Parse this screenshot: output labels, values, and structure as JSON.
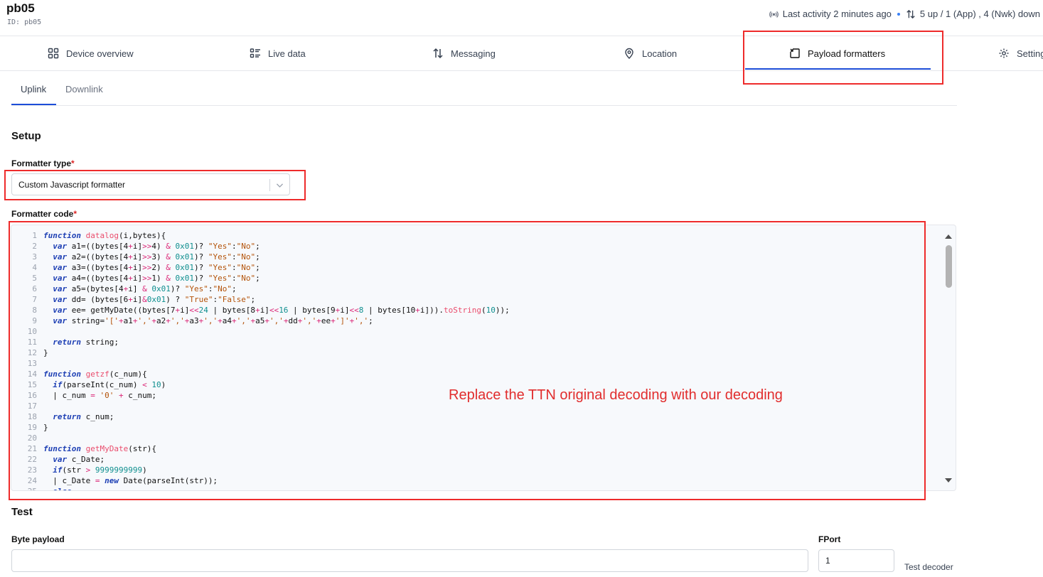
{
  "device": {
    "name": "pb05",
    "id_line": "ID: pb05"
  },
  "status": {
    "last_activity": "Last activity 2 minutes ago",
    "traffic": "5 up / 1 (App) , 4 (Nwk) down"
  },
  "tabs": [
    {
      "label": "Device overview",
      "icon": "grid-icon"
    },
    {
      "label": "Live data",
      "icon": "list-icon"
    },
    {
      "label": "Messaging",
      "icon": "arrows-updown-icon"
    },
    {
      "label": "Location",
      "icon": "location-pin-icon"
    },
    {
      "label": "Payload formatters",
      "icon": "formatter-icon",
      "active": true
    },
    {
      "label": "Settings",
      "icon": "gear-icon"
    }
  ],
  "subtabs": [
    {
      "label": "Uplink",
      "active": true
    },
    {
      "label": "Downlink"
    }
  ],
  "setup": {
    "heading": "Setup",
    "formatter_type_label": "Formatter type",
    "formatter_type_value": "Custom Javascript formatter",
    "formatter_code_label": "Formatter code",
    "required_mark": "*"
  },
  "code_lines": [
    {
      "n": "1",
      "segs": [
        [
          "function",
          "kw"
        ],
        [
          " ",
          ""
        ],
        [
          "datalog",
          "fn"
        ],
        [
          "(i,bytes){",
          ""
        ]
      ]
    },
    {
      "n": "2",
      "segs": [
        [
          "  ",
          ""
        ],
        [
          "var",
          "kw"
        ],
        [
          " a1=((bytes[4",
          ""
        ],
        [
          "+",
          "op"
        ],
        [
          "i]",
          ""
        ],
        [
          ">>",
          "op"
        ],
        [
          "4) ",
          ""
        ],
        [
          "&",
          "op"
        ],
        [
          " ",
          ""
        ],
        [
          "0x01",
          "num"
        ],
        [
          ")? ",
          ""
        ],
        [
          "\"Yes\"",
          "str"
        ],
        [
          ":",
          ""
        ],
        [
          "\"No\"",
          "str"
        ],
        [
          ";",
          ""
        ]
      ]
    },
    {
      "n": "3",
      "segs": [
        [
          "  ",
          ""
        ],
        [
          "var",
          "kw"
        ],
        [
          " a2=((bytes[4",
          ""
        ],
        [
          "+",
          "op"
        ],
        [
          "i]",
          ""
        ],
        [
          ">>",
          "op"
        ],
        [
          "3) ",
          ""
        ],
        [
          "&",
          "op"
        ],
        [
          " ",
          ""
        ],
        [
          "0x01",
          "num"
        ],
        [
          ")? ",
          ""
        ],
        [
          "\"Yes\"",
          "str"
        ],
        [
          ":",
          ""
        ],
        [
          "\"No\"",
          "str"
        ],
        [
          ";",
          ""
        ]
      ]
    },
    {
      "n": "4",
      "segs": [
        [
          "  ",
          ""
        ],
        [
          "var",
          "kw"
        ],
        [
          " a3=((bytes[4",
          ""
        ],
        [
          "+",
          "op"
        ],
        [
          "i]",
          ""
        ],
        [
          ">>",
          "op"
        ],
        [
          "2) ",
          ""
        ],
        [
          "&",
          "op"
        ],
        [
          " ",
          ""
        ],
        [
          "0x01",
          "num"
        ],
        [
          ")? ",
          ""
        ],
        [
          "\"Yes\"",
          "str"
        ],
        [
          ":",
          ""
        ],
        [
          "\"No\"",
          "str"
        ],
        [
          ";",
          ""
        ]
      ]
    },
    {
      "n": "5",
      "segs": [
        [
          "  ",
          ""
        ],
        [
          "var",
          "kw"
        ],
        [
          " a4=((bytes[4",
          ""
        ],
        [
          "+",
          "op"
        ],
        [
          "i]",
          ""
        ],
        [
          ">>",
          "op"
        ],
        [
          "1) ",
          ""
        ],
        [
          "&",
          "op"
        ],
        [
          " ",
          ""
        ],
        [
          "0x01",
          "num"
        ],
        [
          ")? ",
          ""
        ],
        [
          "\"Yes\"",
          "str"
        ],
        [
          ":",
          ""
        ],
        [
          "\"No\"",
          "str"
        ],
        [
          ";",
          ""
        ]
      ]
    },
    {
      "n": "6",
      "segs": [
        [
          "  ",
          ""
        ],
        [
          "var",
          "kw"
        ],
        [
          " a5=(bytes[4",
          ""
        ],
        [
          "+",
          "op"
        ],
        [
          "i] ",
          ""
        ],
        [
          "&",
          "op"
        ],
        [
          " ",
          ""
        ],
        [
          "0x01",
          "num"
        ],
        [
          ")? ",
          ""
        ],
        [
          "\"Yes\"",
          "str"
        ],
        [
          ":",
          ""
        ],
        [
          "\"No\"",
          "str"
        ],
        [
          ";",
          ""
        ]
      ]
    },
    {
      "n": "7",
      "segs": [
        [
          "  ",
          ""
        ],
        [
          "var",
          "kw"
        ],
        [
          " dd= (bytes[6",
          ""
        ],
        [
          "+",
          "op"
        ],
        [
          "i]",
          ""
        ],
        [
          "&",
          "op"
        ],
        [
          "0x01",
          "num"
        ],
        [
          ") ? ",
          ""
        ],
        [
          "\"True\"",
          "str"
        ],
        [
          ":",
          ""
        ],
        [
          "\"False\"",
          "str"
        ],
        [
          ";",
          ""
        ]
      ]
    },
    {
      "n": "8",
      "segs": [
        [
          "  ",
          ""
        ],
        [
          "var",
          "kw"
        ],
        [
          " ee= getMyDate((bytes[7",
          ""
        ],
        [
          "+",
          "op"
        ],
        [
          "i]",
          ""
        ],
        [
          "<<",
          "op"
        ],
        [
          "24",
          "num"
        ],
        [
          " | bytes[8",
          ""
        ],
        [
          "+",
          "op"
        ],
        [
          "i]",
          ""
        ],
        [
          "<<",
          "op"
        ],
        [
          "16",
          "num"
        ],
        [
          " | bytes[9",
          ""
        ],
        [
          "+",
          "op"
        ],
        [
          "i]",
          ""
        ],
        [
          "<<",
          "op"
        ],
        [
          "8",
          "num"
        ],
        [
          " | bytes[10",
          ""
        ],
        [
          "+",
          "op"
        ],
        [
          "i])).",
          ""
        ],
        [
          "toString",
          "fn"
        ],
        [
          "(",
          ""
        ],
        [
          "10",
          "num"
        ],
        [
          "));",
          ""
        ]
      ]
    },
    {
      "n": "9",
      "segs": [
        [
          "  ",
          ""
        ],
        [
          "var",
          "kw"
        ],
        [
          " string=",
          ""
        ],
        [
          "'['",
          "str"
        ],
        [
          "+",
          "op"
        ],
        [
          "a1",
          ""
        ],
        [
          "+",
          "op"
        ],
        [
          "','",
          "str"
        ],
        [
          "+",
          "op"
        ],
        [
          "a2",
          ""
        ],
        [
          "+",
          "op"
        ],
        [
          "','",
          "str"
        ],
        [
          "+",
          "op"
        ],
        [
          "a3",
          ""
        ],
        [
          "+",
          "op"
        ],
        [
          "','",
          "str"
        ],
        [
          "+",
          "op"
        ],
        [
          "a4",
          ""
        ],
        [
          "+",
          "op"
        ],
        [
          "','",
          "str"
        ],
        [
          "+",
          "op"
        ],
        [
          "a5",
          ""
        ],
        [
          "+",
          "op"
        ],
        [
          "','",
          "str"
        ],
        [
          "+",
          "op"
        ],
        [
          "dd",
          ""
        ],
        [
          "+",
          "op"
        ],
        [
          "','",
          "str"
        ],
        [
          "+",
          "op"
        ],
        [
          "ee",
          ""
        ],
        [
          "+",
          "op"
        ],
        [
          "']'",
          "str"
        ],
        [
          "+",
          "op"
        ],
        [
          "','",
          "str"
        ],
        [
          ";",
          ""
        ]
      ]
    },
    {
      "n": "10",
      "segs": []
    },
    {
      "n": "11",
      "segs": [
        [
          "  ",
          ""
        ],
        [
          "return",
          "kw"
        ],
        [
          " string;",
          ""
        ]
      ]
    },
    {
      "n": "12",
      "segs": [
        [
          "}",
          ""
        ]
      ]
    },
    {
      "n": "13",
      "segs": []
    },
    {
      "n": "14",
      "segs": [
        [
          "function",
          "kw"
        ],
        [
          " ",
          ""
        ],
        [
          "getzf",
          "fn"
        ],
        [
          "(c_num){",
          ""
        ]
      ]
    },
    {
      "n": "15",
      "segs": [
        [
          "  ",
          ""
        ],
        [
          "if",
          "kw"
        ],
        [
          "(parseInt(c_num) ",
          ""
        ],
        [
          "<",
          "op"
        ],
        [
          " ",
          ""
        ],
        [
          "10",
          "num"
        ],
        [
          ")",
          ""
        ]
      ]
    },
    {
      "n": "16",
      "segs": [
        [
          "  | c_num ",
          ""
        ],
        [
          "=",
          "op"
        ],
        [
          " ",
          ""
        ],
        [
          "'0'",
          "str"
        ],
        [
          " ",
          ""
        ],
        [
          "+",
          "op"
        ],
        [
          " c_num;",
          ""
        ]
      ]
    },
    {
      "n": "17",
      "segs": []
    },
    {
      "n": "18",
      "segs": [
        [
          "  ",
          ""
        ],
        [
          "return",
          "kw"
        ],
        [
          " c_num;",
          ""
        ]
      ]
    },
    {
      "n": "19",
      "segs": [
        [
          "}",
          ""
        ]
      ]
    },
    {
      "n": "20",
      "segs": []
    },
    {
      "n": "21",
      "segs": [
        [
          "function",
          "kw"
        ],
        [
          " ",
          ""
        ],
        [
          "getMyDate",
          "fn"
        ],
        [
          "(str){",
          ""
        ]
      ]
    },
    {
      "n": "22",
      "segs": [
        [
          "  ",
          ""
        ],
        [
          "var",
          "kw"
        ],
        [
          " c_Date;",
          ""
        ]
      ]
    },
    {
      "n": "23",
      "segs": [
        [
          "  ",
          ""
        ],
        [
          "if",
          "kw"
        ],
        [
          "(str ",
          ""
        ],
        [
          ">",
          "op"
        ],
        [
          " ",
          ""
        ],
        [
          "9999999999",
          "num"
        ],
        [
          ")",
          ""
        ]
      ]
    },
    {
      "n": "24",
      "segs": [
        [
          "  | c_Date ",
          ""
        ],
        [
          "=",
          "op"
        ],
        [
          " ",
          ""
        ],
        [
          "new",
          "kw"
        ],
        [
          " Date(parseInt(str));",
          ""
        ]
      ]
    },
    {
      "n": "25",
      "segs": [
        [
          "  ",
          ""
        ],
        [
          "else",
          "kw"
        ]
      ]
    }
  ],
  "annotation": "Replace the TTN original decoding with our decoding",
  "test": {
    "heading": "Test",
    "byte_payload_label": "Byte payload",
    "byte_payload_value": "",
    "fport_label": "FPort",
    "fport_value": "1",
    "test_button": "Test decoder"
  },
  "colors": {
    "accent": "#1d4ed8",
    "annotation_red": "#ee2b2b",
    "keyword": "#1d3fb4",
    "function": "#ea4c6c",
    "string": "#b45309",
    "number": "#0f8f8f",
    "operator": "#db2777"
  }
}
